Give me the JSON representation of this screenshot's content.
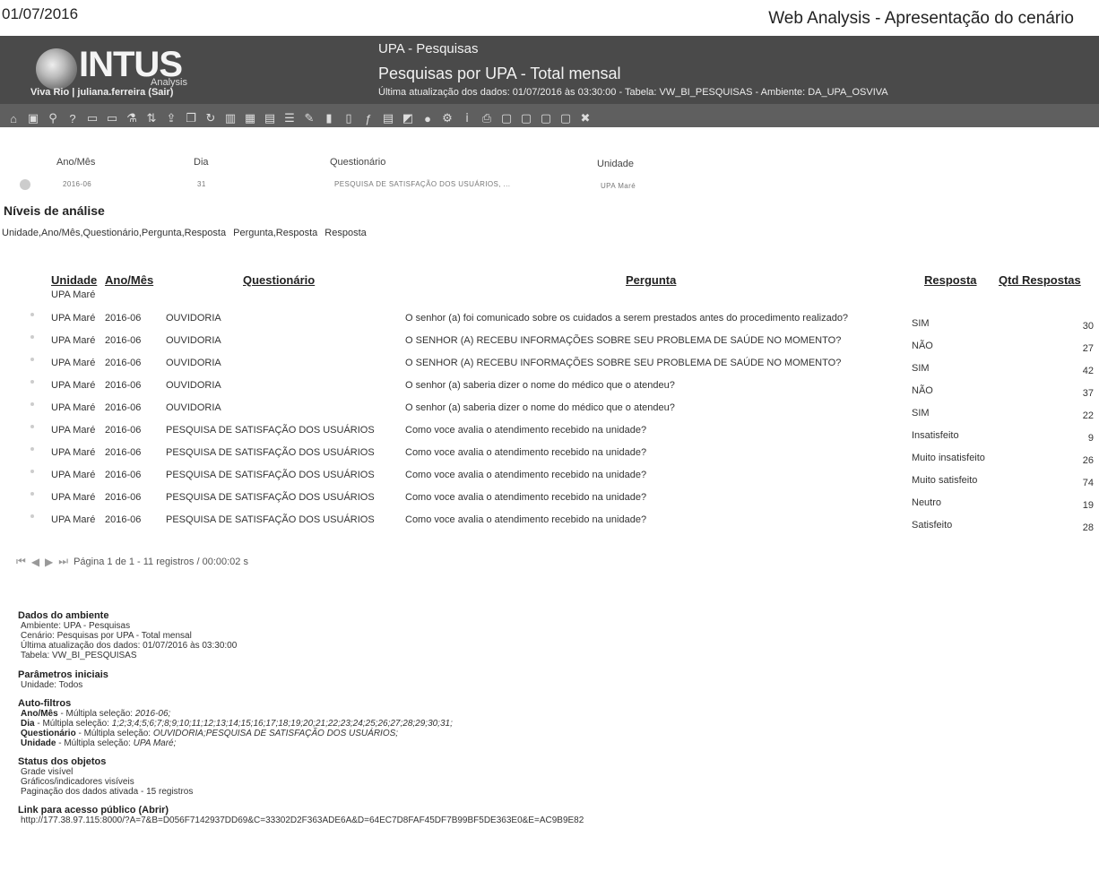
{
  "print": {
    "date": "01/07/2016",
    "title": "Web Analysis - Apresentação do cenário"
  },
  "header": {
    "logo_text": "INTUS",
    "logo_sub": "Analysis",
    "user_prefix": "Viva Rio | juliana.ferreira (",
    "logout_label": "Sair",
    "user_suffix": ")",
    "app_name": "UPA - Pesquisas",
    "scenario_name": "Pesquisas por UPA - Total mensal",
    "update_line": "Última atualização dos dados: 01/07/2016 às 03:30:00 - Tabela: VW_BI_PESQUISAS - Ambiente: DA_UPA_OSVIVA"
  },
  "toolbar_icons": [
    "home-icon",
    "save-icon",
    "search-icon",
    "help-icon",
    "monitor-icon",
    "monitor2-icon",
    "filter-icon",
    "sort-icon",
    "export-icon",
    "copy-icon",
    "refresh-icon",
    "columns-icon",
    "grid-icon",
    "table-icon",
    "list-icon",
    "edit-icon",
    "chart-icon",
    "bars-icon",
    "function-icon",
    "report-icon",
    "graph-icon",
    "globe-icon",
    "settings-icon",
    "info-icon",
    "print-icon",
    "doc-icon",
    "doc2-icon",
    "doc3-icon",
    "doc4-icon",
    "close-icon"
  ],
  "filters": [
    {
      "label": "Ano/Mês",
      "value": "2016-06"
    },
    {
      "label": "Dia",
      "value": "31"
    },
    {
      "label": "Questionário",
      "value": "PESQUISA DE SATISFAÇÃO DOS USUÁRIOS, ..."
    },
    {
      "label": "Unidade",
      "value": "UPA Maré"
    }
  ],
  "levels": {
    "title": "Níveis de análise",
    "items": [
      "Unidade,Ano/Mês,Questionário,Pergunta,Resposta",
      "Pergunta,Resposta",
      "Resposta"
    ]
  },
  "table": {
    "columns": [
      "Unidade",
      "Ano/Mês",
      "Questionário",
      "Pergunta",
      "Resposta",
      "Qtd Respostas"
    ],
    "group_label": "UPA Maré",
    "rows": [
      [
        "UPA Maré",
        "2016-06",
        "OUVIDORIA",
        "O senhor (a) foi comunicado sobre os cuidados a serem prestados antes do procedimento realizado?",
        "SIM",
        "30"
      ],
      [
        "UPA Maré",
        "2016-06",
        "OUVIDORIA",
        "O SENHOR (A) RECEBU INFORMAÇÕES SOBRE SEU PROBLEMA DE SAÚDE NO MOMENTO?",
        "NÃO",
        "27"
      ],
      [
        "UPA Maré",
        "2016-06",
        "OUVIDORIA",
        "O SENHOR (A) RECEBU INFORMAÇÕES SOBRE SEU PROBLEMA DE SAÚDE NO MOMENTO?",
        "SIM",
        "42"
      ],
      [
        "UPA Maré",
        "2016-06",
        "OUVIDORIA",
        "O senhor (a) saberia dizer o nome do médico que o atendeu?",
        "NÃO",
        "37"
      ],
      [
        "UPA Maré",
        "2016-06",
        "OUVIDORIA",
        "O senhor (a) saberia dizer o nome do médico que o atendeu?",
        "SIM",
        "22"
      ],
      [
        "UPA Maré",
        "2016-06",
        "PESQUISA DE SATISFAÇÃO DOS USUÁRIOS",
        "Como voce avalia o atendimento recebido na unidade?",
        "Insatisfeito",
        "9"
      ],
      [
        "UPA Maré",
        "2016-06",
        "PESQUISA DE SATISFAÇÃO DOS USUÁRIOS",
        "Como voce avalia o atendimento recebido na unidade?",
        "Muito insatisfeito",
        "26"
      ],
      [
        "UPA Maré",
        "2016-06",
        "PESQUISA DE SATISFAÇÃO DOS USUÁRIOS",
        "Como voce avalia o atendimento recebido na unidade?",
        "Muito satisfeito",
        "74"
      ],
      [
        "UPA Maré",
        "2016-06",
        "PESQUISA DE SATISFAÇÃO DOS USUÁRIOS",
        "Como voce avalia o atendimento recebido na unidade?",
        "Neutro",
        "19"
      ],
      [
        "UPA Maré",
        "2016-06",
        "PESQUISA DE SATISFAÇÃO DOS USUÁRIOS",
        "Como voce avalia o atendimento recebido na unidade?",
        "Satisfeito",
        "28"
      ]
    ]
  },
  "pager": {
    "text": "Página 1 de 1 - 11 registros / 00:00:02 s"
  },
  "info": {
    "env_title": "Dados do ambiente",
    "env_lines": [
      "Ambiente: UPA - Pesquisas",
      "Cenário: Pesquisas por UPA - Total mensal",
      "Última atualização dos dados: 01/07/2016 às 03:30:00",
      "Tabela: VW_BI_PESQUISAS"
    ],
    "params_title": "Parâmetros iniciais",
    "params_lines": [
      "Unidade: Todos"
    ],
    "auto_title": "Auto-filtros",
    "auto_lines": [
      {
        "name": "Ano/Mês",
        "mode": " - Múltipla seleção: ",
        "values": "2016-06;"
      },
      {
        "name": "Dia",
        "mode": " - Múltipla seleção: ",
        "values": "1;2;3;4;5;6;7;8;9;10;11;12;13;14;15;16;17;18;19;20;21;22;23;24;25;26;27;28;29;30;31;"
      },
      {
        "name": "Questionário",
        "mode": " - Múltipla seleção: ",
        "values": "OUVIDORIA;PESQUISA DE SATISFAÇÃO DOS USUÁRIOS;"
      },
      {
        "name": "Unidade",
        "mode": " - Múltipla seleção: ",
        "values": "UPA Maré;"
      }
    ],
    "status_title": "Status dos objetos",
    "status_lines": [
      "Grade visível",
      "Gráficos/indicadores visíveis",
      "Paginação dos dados ativada - 15 registros"
    ],
    "link_title": "Link para acesso público (Abrir)",
    "link_url": "http://177.38.97.115:8000/?A=7&B=D056F7142937DD69&C=33302D2F363ADE6A&D=64EC7D8FAF45DF7B99BF5DE363E0&E=AC9B9E82"
  }
}
